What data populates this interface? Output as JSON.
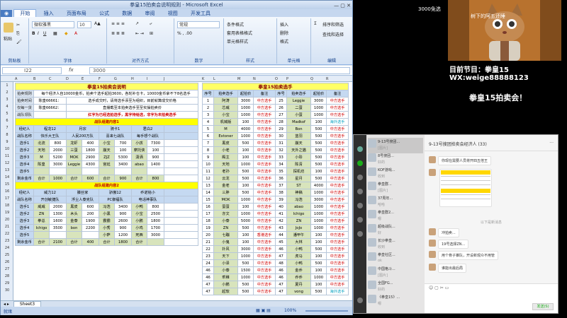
{
  "excel": {
    "title": "拳皇15拍卖会说明规则 - Microsoft Excel",
    "win_controls": "— ▢ ✕",
    "tabs": [
      "开始",
      "插入",
      "页面布局",
      "公式",
      "数据",
      "审阅",
      "视图",
      "开发工具"
    ],
    "font_name": "微软雅黑",
    "font_size": "10",
    "number_format": "常规",
    "groups": [
      "剪贴板",
      "字体",
      "对齐方式",
      "数字",
      "样式",
      "单元格",
      "编辑"
    ],
    "ribbon_buttons": {
      "paste": "粘贴",
      "cond_format": "条件格式",
      "table_format": "套用表格格式",
      "cell_style": "单元格样式",
      "insert": "插入",
      "delete": "删除",
      "format": "格式",
      "sort": "排序和筛选",
      "find": "查找和选择"
    },
    "name_box": "I22",
    "fx": "fx",
    "formula_value": "3000",
    "sheet_tab": "Sheet3",
    "status": "就绪",
    "zoom": "100%"
  },
  "left_sheet": {
    "title": "拳皇15拍卖会说明",
    "rules": [
      [
        "拍卖规则",
        "每个经济人自10000金币，拍卖个选手起拍3600，各轮补仓卡，10000金币拿不下8名选手"
      ],
      [
        "拍卖时间",
        "陈皇66661：",
        "选手成交时，请将选手添至为组织，目前就算成交价格"
      ],
      [
        "仅每一货",
        "陈皇66662：",
        "直播截至本拍卖选手至至实操拍卖价"
      ],
      [
        "战队领队",
        "",
        "红字为已经选拍选手，黑字待给选，非字为未拍卖选手"
      ]
    ],
    "team1_title": "战队组建内容1",
    "team2_title": "战队组建内容2",
    "team1_header": [
      "经纪人",
      "",
      "程龙12",
      "",
      "月宗",
      "",
      "骑卡1",
      "",
      "君白2",
      ""
    ],
    "team1_sub": [
      "战队名称",
      "",
      "快乐大王队",
      "",
      "人民200万队",
      "",
      "喜来七战队",
      "",
      "每手想个战队",
      ""
    ],
    "team1_rows": [
      [
        "选手1",
        "北流",
        "800",
        "龙虾",
        "400",
        "小宝",
        "700",
        "小孩",
        "7300"
      ],
      [
        "选手2",
        "天地",
        "2000",
        "三蛋",
        "1800",
        "崩天",
        "100",
        "摩托侠",
        "100"
      ],
      [
        "选手3",
        "M",
        "5200",
        "MOK",
        "2900",
        "ZJZ",
        "5300",
        "潇洒",
        "900"
      ],
      [
        "选手4",
        "陈皇",
        "3000",
        "Leggie",
        "4300",
        "宫廷",
        "3400",
        "abao",
        "1400"
      ],
      [
        "选手5",
        "",
        "",
        "",
        "",
        "",
        "",
        "",
        ""
      ],
      [
        "剩余金币",
        "合计",
        "1000",
        "合计",
        "600",
        "合计",
        "900",
        "合计",
        "800"
      ]
    ],
    "team2_header": [
      "经纪人",
      "",
      "威力12",
      "",
      "滕丝家",
      "",
      "骄傲12",
      "",
      "乔诺铭小",
      ""
    ],
    "team2_sub": [
      "战队名称",
      "",
      "开创敏捷队",
      "",
      "浮尘人泰克队",
      "",
      "PC御福队",
      "",
      "电话神事队",
      ""
    ],
    "team2_rows": [
      [
        "选手1",
        "威威",
        "2000",
        "黑皮",
        "600",
        "冯浩",
        "3400",
        "小鸭",
        "800"
      ],
      [
        "选手2",
        "ZN",
        "1300",
        "木头",
        "200",
        "小黑",
        "900",
        "小宝",
        "2500"
      ],
      [
        "选手3",
        "拳总",
        "1600",
        "金泰",
        "1900",
        "霸霸",
        "2600",
        "小鹏",
        "1800"
      ],
      [
        "选手4",
        "Ichigo",
        "3500",
        "bon",
        "2200",
        "小秀",
        "900",
        "小鸡",
        "1700"
      ],
      [
        "选手5",
        "",
        "",
        "",
        "",
        "小萨",
        "1200",
        "死西",
        "3000"
      ],
      [
        "剩余金币",
        "合计",
        "2100",
        "合计",
        "400",
        "合计",
        "1800",
        "合计",
        ""
      ]
    ]
  },
  "right_sheet": {
    "title": "拳皇15拍卖选手",
    "headers": [
      "序号",
      "拍卖选手",
      "起拍价",
      "备注",
      "序号",
      "拍卖选手",
      "起拍价",
      "备注"
    ],
    "rows": [
      [
        "1",
        "阿涛",
        "3000",
        "中方选手",
        "25",
        "Leggie",
        "3000",
        "中方选手"
      ],
      [
        "2",
        "芯威",
        "1000",
        "中方选手",
        "26",
        "二蛋",
        "1000",
        "中方选手"
      ],
      [
        "3",
        "小宝",
        "1000",
        "中方选手",
        "27",
        "小蛋",
        "1000",
        "中方选手"
      ],
      [
        "4",
        "机械版",
        "100",
        "中方选手",
        "28",
        "Madkof",
        "100",
        "海外选手"
      ],
      [
        "5",
        "M",
        "4000",
        "中方选手",
        "29",
        "Bon",
        "500",
        "中方选手"
      ],
      [
        "6",
        "Extoner",
        "1000",
        "中方选手",
        "30",
        "蓝羽",
        "500",
        "中方选手"
      ],
      [
        "7",
        "黑皮",
        "500",
        "中方选手",
        "31",
        "崩天",
        "500",
        "中方选手"
      ],
      [
        "8",
        "小老",
        "100",
        "中方选手",
        "32",
        "天外之猫",
        "500",
        "中方选手"
      ],
      [
        "9",
        "殿主",
        "100",
        "中方选手",
        "33",
        "小彤",
        "500",
        "中方选手"
      ],
      [
        "10",
        "天地",
        "1000",
        "中方选手",
        "34",
        "陈清",
        "500",
        "中方选手"
      ],
      [
        "11",
        "老孙",
        "500",
        "中方选手",
        "35",
        "探机坊",
        "100",
        "中方选手"
      ],
      [
        "12",
        "云龙",
        "500",
        "中方选手",
        "36",
        "星月",
        "500",
        "中方选手"
      ],
      [
        "13",
        "金老",
        "100",
        "中方选手",
        "37",
        "ST",
        "4000",
        "中方选手"
      ],
      [
        "14",
        "三胖",
        "500",
        "中方选手",
        "38",
        "神稿",
        "1000",
        "中方选手"
      ],
      [
        "15",
        "MOK",
        "1000",
        "中方选手",
        "39",
        "冯浩",
        "3000",
        "中方选手"
      ],
      [
        "16",
        "蛋蛋",
        "100",
        "中方选手",
        "40",
        "abao",
        "1000",
        "中方选手"
      ],
      [
        "17",
        "亦文",
        "1000",
        "中方选手",
        "41",
        "Ichigo",
        "1000",
        "中方选手"
      ],
      [
        "18",
        "小泰",
        "5000",
        "中方选手",
        "42",
        "ZN",
        "1000",
        "中方选手"
      ],
      [
        "19",
        "ZN",
        "500",
        "中方选手",
        "43",
        "JoJo",
        "1000",
        "中方选手"
      ],
      [
        "20",
        "七蹦",
        "100",
        "香港选手",
        "44",
        "潘甲午",
        "100",
        "中方选手"
      ],
      [
        "21",
        "小鬼",
        "100",
        "中方选手",
        "45",
        "大林",
        "100",
        "中方选手"
      ],
      [
        "22",
        "扑风",
        "3000",
        "中方选手",
        "46",
        "小鸭",
        "500",
        "中方选手"
      ],
      [
        "23",
        "天下",
        "1000",
        "中方选手",
        "47",
        "虎马",
        "100",
        "中方选手"
      ],
      [
        "24",
        "小泽",
        "500",
        "中方选手",
        "48",
        "小鸭",
        "500",
        "中方选手"
      ],
      [
        "46",
        "小泰",
        "1500",
        "中方选手",
        "46",
        "金乔",
        "100",
        "中方选手"
      ],
      [
        "46",
        "乖稚",
        "1000",
        "中方选手",
        "46",
        "乔乔",
        "1000",
        "中方选手"
      ],
      [
        "47",
        "小鹏",
        "500",
        "中方选手",
        "47",
        "夏丹",
        "100",
        "中方选手"
      ],
      [
        "47",
        "起软",
        "500",
        "中方选手",
        "47",
        "vong",
        "500",
        "海外选手"
      ]
    ]
  },
  "stream": {
    "label": "3000免选",
    "cat_caption": "树下的阿五还睡",
    "program": "目前节目：拳皇15",
    "wx": "WX:weige88888123",
    "auction": "拳皇15拍卖会！"
  },
  "chat": {
    "title": "9-13号搜团拍卖会经济人 (33)",
    "list": [
      [
        "9-13号搜团...",
        "[图片]"
      ],
      [
        "8号搜团...",
        "好的"
      ],
      [
        "KOF游戏...",
        "收到"
      ],
      [
        "拳皇群...",
        "[图片]"
      ],
      [
        "37周年...",
        "哈哈"
      ],
      [
        "拳皇群2...",
        "嗯"
      ],
      [
        "超级战队...",
        "好"
      ],
      [
        "长沙拳皇...",
        "收到"
      ],
      [
        "拳皇社区...",
        "ok"
      ],
      [
        "中国格斗...",
        "[图片]"
      ],
      [
        "全国FG...",
        "好的"
      ],
      [
        "《拳皇15》...",
        "嗯"
      ]
    ],
    "messages": [
      "你现在需要人员将开四五倍王",
      "冲拍卖...",
      "19号选择ZN...",
      "用个骨子锥队，开设新观众不用管",
      "谁能出最后局"
    ],
    "send_button": "发送(S)",
    "divider": "以下是新消息"
  }
}
